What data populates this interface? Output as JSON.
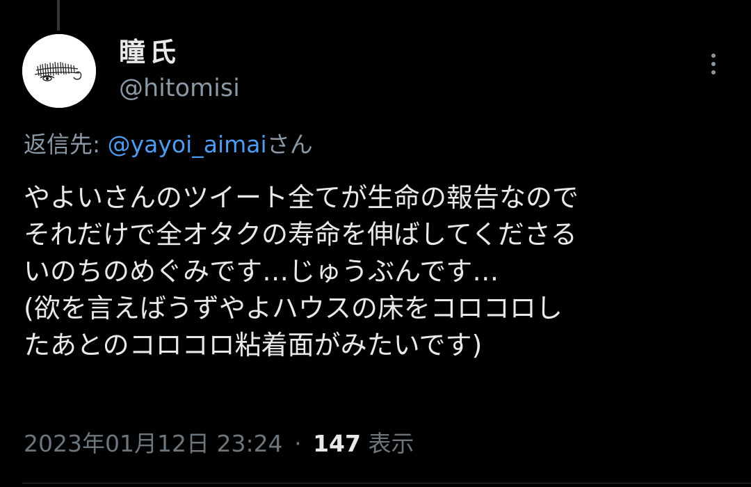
{
  "tweet": {
    "author": {
      "display_name": "瞳氏",
      "handle": "@hitomisi"
    },
    "reply_to": {
      "prefix": "返信先: ",
      "mention": "@yayoi_aimai",
      "suffix": "さん"
    },
    "text_lines": [
      "やよいさんのツイート全てが生命の報告なので",
      "それだけで全オタクの寿命を伸ばしてくださる",
      "いのちのめぐみです…じゅうぶんです…",
      "(欲を言えばうずやよハウスの床をコロコロし",
      "たあとのコロコロ粘着面がみたいです)"
    ],
    "timestamp": "2023年01月12日 23:24",
    "separator": "·",
    "views": {
      "count": "147",
      "label": "表示"
    }
  },
  "icons": {
    "more": "more-vertical-icon",
    "avatar": "avatar-image"
  },
  "colors": {
    "background": "#000000",
    "primary_text": "#e7e9ea",
    "secondary_text": "#8b98a5",
    "link": "#4e9bf0"
  }
}
